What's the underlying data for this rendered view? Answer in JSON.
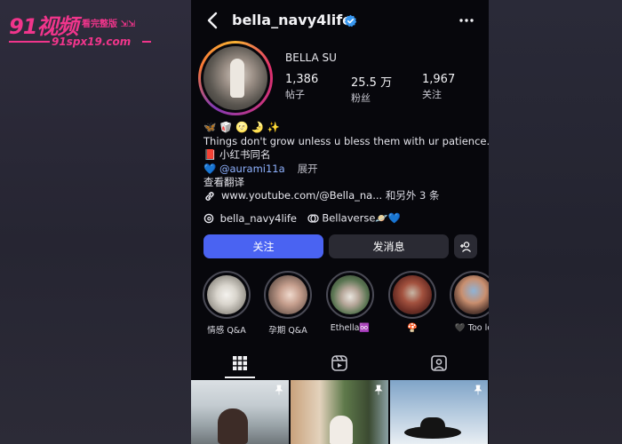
{
  "watermark": {
    "logo": "91视频",
    "tagline": "看完整版 ⇲⇲",
    "url": "91spx19.com"
  },
  "profile": {
    "username": "bella_navy4life",
    "display_name": "BELLA SU",
    "stats": [
      {
        "value": "1,386",
        "label": "帖子"
      },
      {
        "value": "25.5 万",
        "label": "粉丝"
      },
      {
        "value": "1,967",
        "label": "关注"
      }
    ],
    "bio": {
      "emoji_line": "🦋 🥡 🌝 🌛 ✨",
      "line1": "Things don't grow unless u bless them with ur patience.",
      "line2": "📕 小红书同名",
      "line3_prefix": "💙 ",
      "mention": "@aurami11a",
      "expand": "展开",
      "translate": "查看翻译"
    },
    "link": {
      "url": "www.youtube.com/@Bella_na...",
      "more": " 和另外 3 条"
    },
    "threads": {
      "handle": "bella_navy4life",
      "tag": "Bellaverse🪐💙"
    }
  },
  "buttons": {
    "follow": "关注",
    "message": "发消息"
  },
  "highlights": [
    {
      "label": "情感 Q&A"
    },
    {
      "label": "孕期 Q&A"
    },
    {
      "label": "Ethella♾️"
    },
    {
      "label": "🍄"
    },
    {
      "label": "🖤 Too le"
    }
  ],
  "colors": {
    "follow_button": "#4a63f2",
    "verified": "#3897f0",
    "watermark": "#f0358b"
  }
}
